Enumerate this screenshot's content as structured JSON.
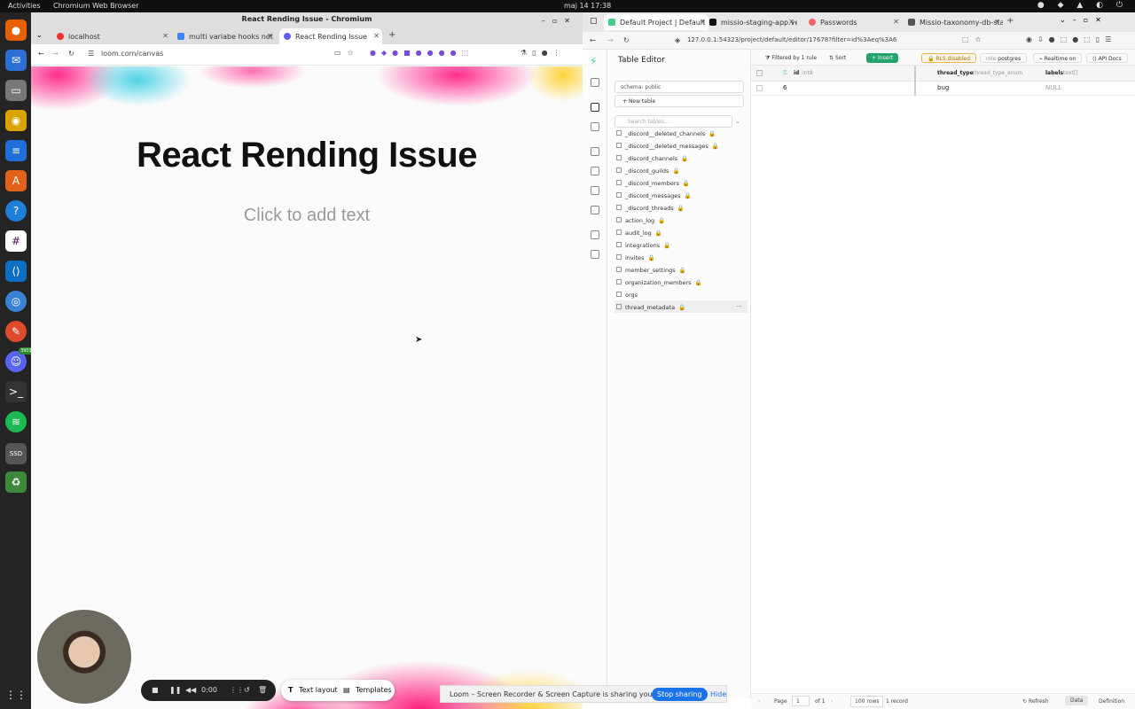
{
  "system": {
    "activities": "Activities",
    "app_name": "Chromium Web Browser",
    "clock": "maj 14  17:38"
  },
  "dock": {
    "discord_badge": "3903",
    "ssd_label": "SSD"
  },
  "left_window": {
    "title": "React Rending Issue - Chromium",
    "tabs": [
      {
        "label": "localhost",
        "active": false
      },
      {
        "label": "multi variabe hooks not",
        "active": false
      },
      {
        "label": "React Rending Issue",
        "active": true
      }
    ],
    "url": "loom.com/canvas",
    "canvas": {
      "heading": "React Rending Issue",
      "placeholder": "Click to add text"
    },
    "recorder": {
      "time": "0:00",
      "text_layout": "Text layout",
      "templates": "Templates"
    },
    "share_bar": {
      "message": "Loom – Screen Recorder & Screen Capture is sharing your screen.",
      "stop": "Stop sharing",
      "hide": "Hide"
    }
  },
  "right_window": {
    "tabs": [
      {
        "label": "Default Project | Default",
        "active": true
      },
      {
        "label": "missio-staging-app.verc",
        "active": false
      },
      {
        "label": "Passwords",
        "active": false
      },
      {
        "label": "Missio-taxonomy-db-stag",
        "active": false
      }
    ],
    "url": "127.0.0.1:54323/project/default/editor/17678?filter=id%3Aeq%3A6",
    "table_editor": {
      "title": "Table Editor",
      "schema": "schema: public",
      "new_table": "New table",
      "search_placeholder": "Search tables...",
      "tables": [
        "_discord__deleted_channels",
        "_discord__deleted_messages",
        "_discord_channels",
        "_discord_guilds",
        "_discord_members",
        "_discord_messages",
        "_discord_threads",
        "action_log",
        "audit_log",
        "integrations",
        "invites",
        "member_settings",
        "organization_members",
        "orgs",
        "thread_metadata"
      ],
      "selected_table": "thread_metadata"
    },
    "toolbar": {
      "filter": "Filtered by 1 rule",
      "sort": "Sort",
      "insert": "Insert",
      "rls": "RLS disabled",
      "role_prefix": "role",
      "role": "postgres",
      "realtime": "Realtime on",
      "api_docs": "API Docs"
    },
    "columns": [
      {
        "name": "id",
        "type": "int8"
      },
      {
        "name": "thread_type",
        "type": "thread_type_enum"
      },
      {
        "name": "labels",
        "type": "text[]"
      }
    ],
    "rows": [
      {
        "id": "6",
        "thread_type": "bug",
        "labels": "NULL"
      }
    ],
    "footer": {
      "page_label": "Page",
      "page": "1",
      "of": "of 1",
      "rows_per_page": "100 rows",
      "record_count": "1 record",
      "refresh": "Refresh",
      "data_tab": "Data",
      "definition_tab": "Definition"
    }
  }
}
